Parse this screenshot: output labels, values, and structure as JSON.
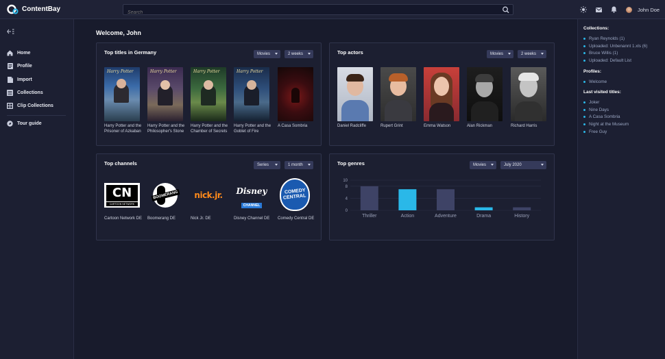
{
  "app": {
    "name": "ContentBay"
  },
  "search": {
    "placeholder": "Search"
  },
  "user": {
    "name": "John Doe"
  },
  "sidebar": {
    "items": [
      {
        "label": "Home",
        "icon": "home-icon"
      },
      {
        "label": "Profile",
        "icon": "profile-icon"
      },
      {
        "label": "Import",
        "icon": "import-icon"
      },
      {
        "label": "Collections",
        "icon": "collections-icon"
      },
      {
        "label": "Clip Collections",
        "icon": "clip-collections-icon"
      }
    ],
    "tour": {
      "label": "Tour guide",
      "icon": "tour-guide-icon"
    }
  },
  "main": {
    "welcome": "Welcome, John"
  },
  "top_titles": {
    "title": "Top titles in Germany",
    "filter_type": "Movies",
    "filter_period": "2 weeks",
    "items": [
      {
        "caption": "Harry Potter and the Prisoner of Azkaban"
      },
      {
        "caption": "Harry Potter and the Philosopher's Stone"
      },
      {
        "caption": "Harry Potter and the Chamber of Secrets"
      },
      {
        "caption": "Harry Potter and the Goblet of Fire"
      },
      {
        "caption": "A Casa Sombria"
      }
    ],
    "poster_logo": "Harry Potter"
  },
  "top_actors": {
    "title": "Top actors",
    "filter_type": "Movies",
    "filter_period": "2 weeks",
    "items": [
      {
        "name": "Daniel Radcliffe"
      },
      {
        "name": "Rupert Grint"
      },
      {
        "name": "Emma Watson"
      },
      {
        "name": "Alan Rickman"
      },
      {
        "name": "Richard Harris"
      }
    ]
  },
  "top_channels": {
    "title": "Top channels",
    "filter_type": "Series",
    "filter_period": "1 month",
    "items": [
      {
        "name": "Cartoon Network DE",
        "logo_text": "CN",
        "logo_sub": "CARTOON NETWORK"
      },
      {
        "name": "Boomerang DE",
        "logo_text": "BOOMERANG"
      },
      {
        "name": "Nick Jr. DE",
        "logo_text": "nick.jr."
      },
      {
        "name": "Disney Channel DE",
        "logo_text": "Disney",
        "logo_sub": "CHANNEL"
      },
      {
        "name": "Comedy Central DE",
        "logo_text": "COMEDY",
        "logo_sub": "CENTRAL"
      }
    ]
  },
  "top_genres": {
    "title": "Top genres",
    "filter_type": "Movies",
    "filter_period": "July 2020",
    "chart_data": {
      "type": "bar",
      "categories": [
        "Thriller",
        "Action",
        "Adventure",
        "Drama",
        "History"
      ],
      "values": [
        8,
        7,
        7,
        1,
        1
      ],
      "yticks": [
        0,
        4,
        8,
        10
      ],
      "ylim": [
        0,
        10
      ],
      "highlight": [
        1,
        3
      ],
      "colors": {
        "default": "#3e4366",
        "highlight": "#2ab8e8"
      },
      "grid": true
    }
  },
  "right_panel": {
    "collections_head": "Collections:",
    "collections": [
      "Ryan Reynolds (1)",
      "Uploaded: Unbenannt 1.xls (6)",
      "Bruce Willis (1)",
      "Uploaded: Default List"
    ],
    "profiles_head": "Profiles:",
    "profiles": [
      "Welcome"
    ],
    "visited_head": "Last visited titles:",
    "visited": [
      "Joker",
      "Nine Days",
      "A Casa Sombria",
      "Night at the Museum",
      "Free Guy"
    ]
  }
}
